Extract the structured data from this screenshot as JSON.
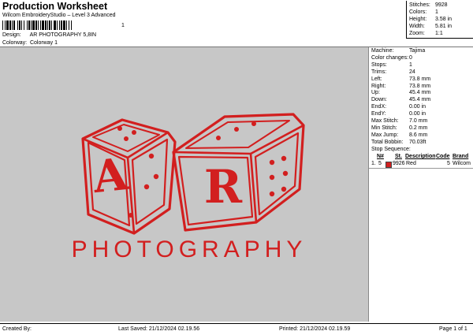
{
  "header": {
    "title": "Production Worksheet",
    "subtitle": "Wilcom EmbroideryStudio – Level 3 Advanced",
    "barcode_suffix": "1",
    "design_label": "Design:",
    "design_value": "AR PHOTOGRAPHY 5,8IN",
    "colorway_label": "Colorway:",
    "colorway_value": "Colorway 1"
  },
  "stats": [
    {
      "label": "Stitches:",
      "value": "9928"
    },
    {
      "label": "Colors:",
      "value": "1"
    },
    {
      "label": "Height:",
      "value": "3.58 in"
    },
    {
      "label": "Width:",
      "value": "5.81 in"
    },
    {
      "label": "Zoom:",
      "value": "1:1"
    }
  ],
  "machine_info": [
    {
      "label": "Machine:",
      "value": "Tajima"
    },
    {
      "label": "Color changes:",
      "value": "0"
    },
    {
      "label": "Stops:",
      "value": "1"
    },
    {
      "label": "Trims:",
      "value": "24"
    },
    {
      "label": "Left:",
      "value": "73.8 mm"
    },
    {
      "label": "Right:",
      "value": "73.8 mm"
    },
    {
      "label": "Up:",
      "value": "45.4 mm"
    },
    {
      "label": "Down:",
      "value": "45.4 mm"
    },
    {
      "label": "EndX:",
      "value": "0.00 in"
    },
    {
      "label": "EndY:",
      "value": "0.00 in"
    },
    {
      "label": "Max Stitch:",
      "value": "7.0 mm"
    },
    {
      "label": "Min Stitch:",
      "value": "0.2 mm"
    },
    {
      "label": "Max Jump:",
      "value": "8.6 mm"
    },
    {
      "label": "Total Bobbin:",
      "value": "70.03ft"
    }
  ],
  "stop_sequence": {
    "title": "Stop Sequence:",
    "columns": [
      "N#",
      "St.",
      "Description",
      "Code",
      "Brand"
    ],
    "rows": [
      {
        "index": "1.",
        "n": "5",
        "st": "9926",
        "description": "Red",
        "code": "5",
        "brand": "Wilcom",
        "color": "#d21f1f"
      }
    ]
  },
  "design_text": {
    "die_left_letter": "A",
    "die_right_letter": "R",
    "word": "PHOTOGRAPHY"
  },
  "colors": {
    "thread": "#d21f1f",
    "background": "#c7c7c7"
  },
  "footer": {
    "created_by": "Created By:",
    "last_saved": "Last Saved: 21/12/2024 02.19.56",
    "printed": "Printed: 21/12/2024 02.19.59",
    "page": "Page 1 of 1"
  }
}
